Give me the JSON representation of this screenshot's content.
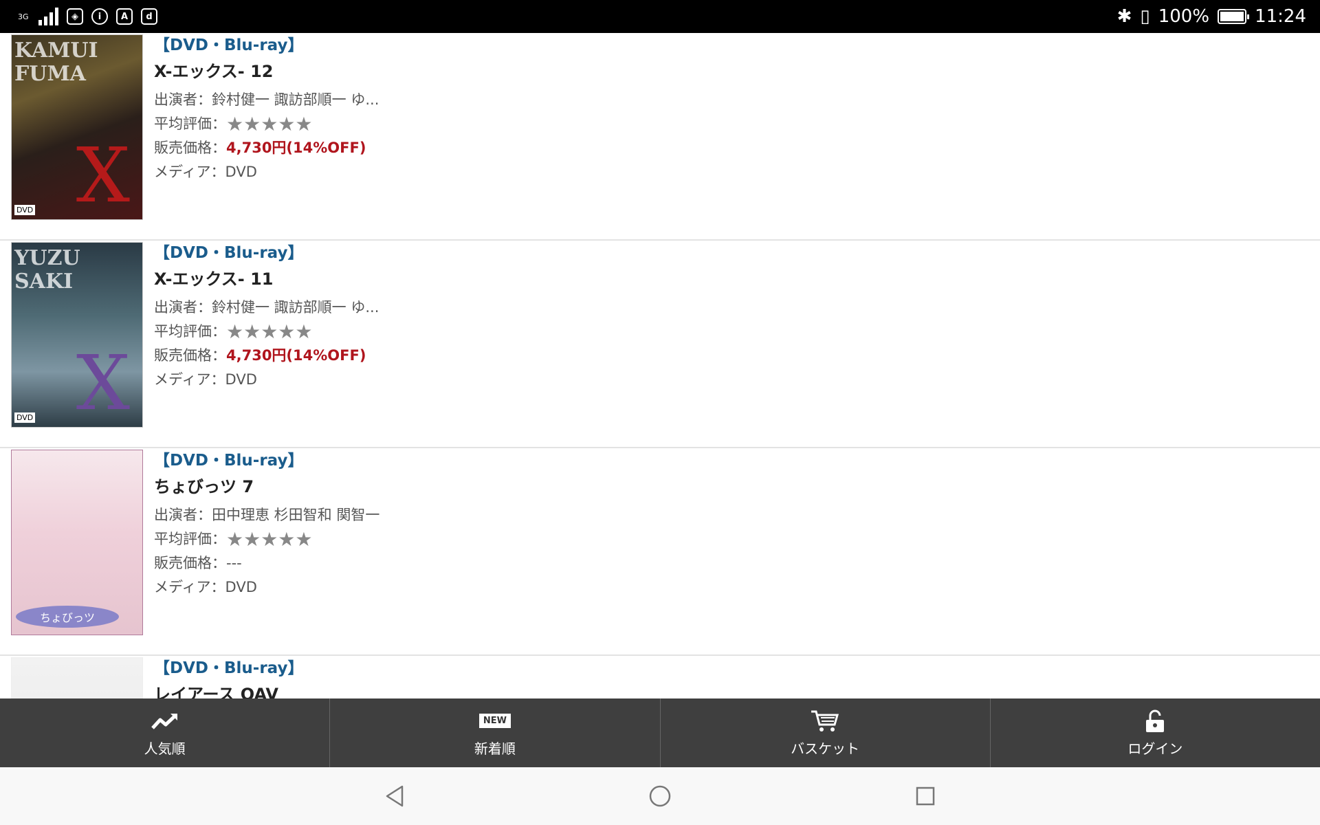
{
  "status_bar": {
    "network": "3G",
    "battery": "100%",
    "time": "11:24",
    "battery_level": 1.0
  },
  "items": [
    {
      "category": "【DVD・Blu-ray】",
      "title": "X-エックス- 12",
      "cast": "出演者：鈴村健一 諏訪部順一 ゆ...",
      "rating_label": "平均評価：",
      "stars": "★★★★★",
      "price_label": "販売価格：",
      "price": "4,730円(14%OFF)",
      "media": "メディア：DVD"
    },
    {
      "category": "【DVD・Blu-ray】",
      "title": "X-エックス- 11",
      "cast": "出演者：鈴村健一 諏訪部順一 ゆ...",
      "rating_label": "平均評価：",
      "stars": "★★★★★",
      "price_label": "販売価格：",
      "price": "4,730円(14%OFF)",
      "media": "メディア：DVD"
    },
    {
      "category": "【DVD・Blu-ray】",
      "title": "ちょびっツ 7",
      "cast": "出演者：田中理恵 杉田智和 関智一",
      "rating_label": "平均評価：",
      "stars": "★★★★★",
      "price_label": "販売価格：",
      "price": "---",
      "media": "メディア：DVD"
    },
    {
      "category": "【DVD・Blu-ray】",
      "title": "レイアース OAV"
    }
  ],
  "tabs": [
    {
      "label": "人気順",
      "icon": "trending-up-icon"
    },
    {
      "label": "新着順",
      "icon": "new-badge-icon",
      "badge": "NEW"
    },
    {
      "label": "バスケット",
      "icon": "cart-icon"
    },
    {
      "label": "ログイン",
      "icon": "unlock-icon"
    }
  ],
  "colors": {
    "category": "#1a5c8c",
    "price": "#b0151d",
    "tabbar": "#3f3f3f"
  }
}
